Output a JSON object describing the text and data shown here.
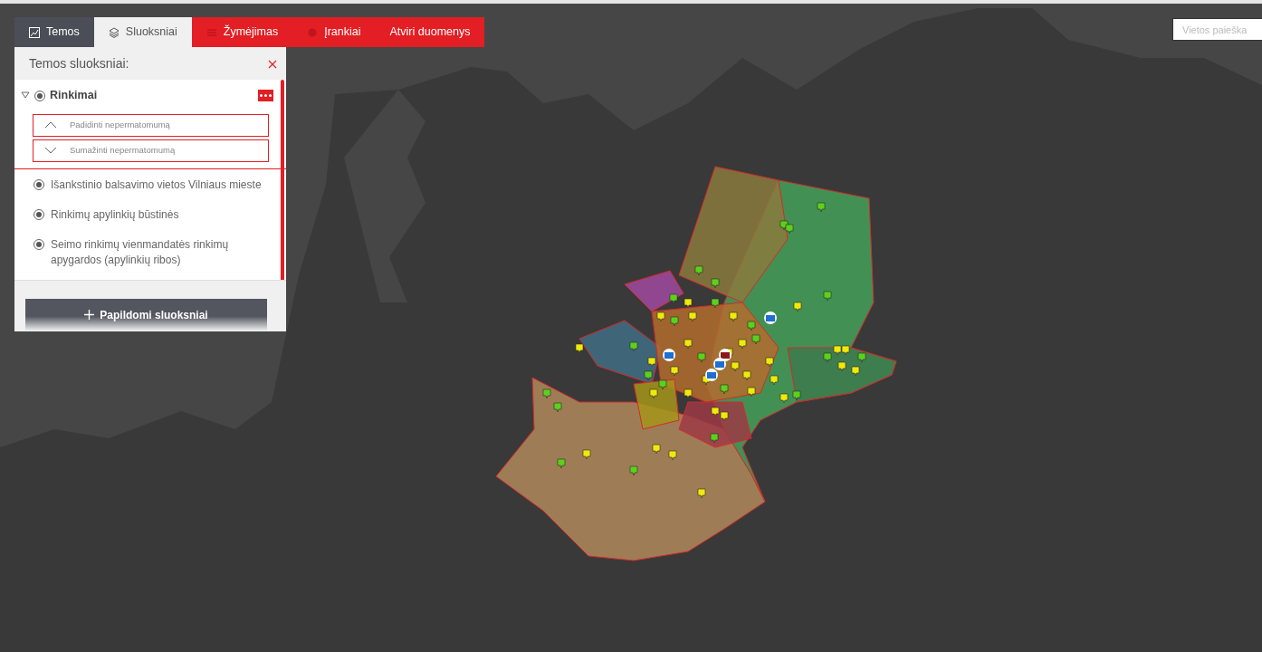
{
  "tabs": [
    {
      "label": "Temos",
      "selected": false,
      "color": "#4b4e57",
      "kind": "themes"
    },
    {
      "label": "Sluoksniai",
      "selected": true,
      "kind": "layers"
    },
    {
      "label": "Žymėjimas",
      "selected": false,
      "color": "#e31e24",
      "kind": "marking"
    },
    {
      "label": "Įrankiai",
      "selected": false,
      "color": "#e31e24",
      "kind": "tools"
    },
    {
      "label": "Atviri duomenys",
      "selected": false,
      "color": "#e31e24",
      "kind": "none"
    }
  ],
  "panel": {
    "title": "Temos sluoksniai:",
    "group": {
      "label": "Rinkimai",
      "expanded": true,
      "checked": true,
      "opacity_buttons": [
        {
          "label": "Padidinti nepermatomumą",
          "kind": "up"
        },
        {
          "label": "Sumažinti nepermatomumą",
          "kind": "down"
        }
      ],
      "children": [
        {
          "label": "Išankstinio balsavimo vietos Vilniaus mieste",
          "checked": true
        },
        {
          "label": "Rinkimų apylinkių būstinės",
          "checked": true
        },
        {
          "label": "Seimo rinkimų vienmandatės rinkimų apygardos (apylinkių ribos)",
          "checked": true
        }
      ]
    },
    "add_button": "Papildomi sluoksniai"
  },
  "search": {
    "placeholder": "Vietos paieška"
  }
}
